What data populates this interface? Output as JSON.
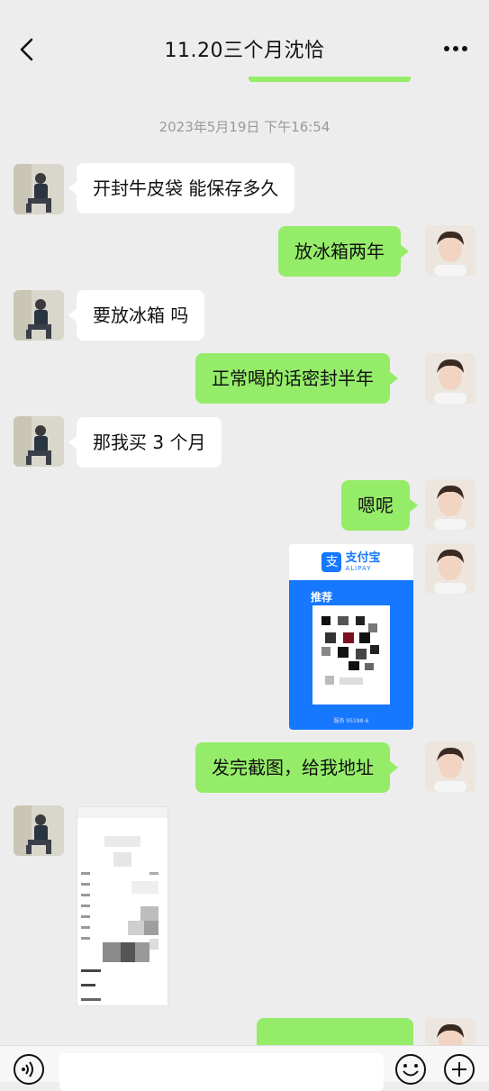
{
  "header": {
    "title": "11.20三个月沈恰",
    "back_icon": "chevron-left-icon",
    "more_icon": "more-dots-icon"
  },
  "timestamp": "2023年5月19日 下午16:54",
  "messages": [
    {
      "side": "in",
      "text": "开封牛皮袋  能保存多久"
    },
    {
      "side": "out",
      "text": "放冰箱两年"
    },
    {
      "side": "in",
      "text": "要放冰箱 吗"
    },
    {
      "side": "out",
      "text": "正常喝的话密封半年"
    },
    {
      "side": "in",
      "text": "那我买 3 个月"
    },
    {
      "side": "out",
      "text": "嗯呢"
    },
    {
      "side": "out",
      "type": "image",
      "text": "alipay-qr-code-image"
    },
    {
      "side": "out",
      "text": "发完截图，给我地址"
    },
    {
      "side": "in",
      "type": "image",
      "text": "screenshot-image"
    }
  ],
  "alipay": {
    "logo": "支",
    "name": "支付宝",
    "en": "ALIPAY",
    "label": "推荐",
    "footer": "服务 95188-6"
  },
  "colors": {
    "background": "#ededed",
    "outgoing_bubble": "#95ec69",
    "incoming_bubble": "#ffffff",
    "alipay_blue": "#1677ff"
  },
  "composer": {
    "voice_icon": "voice-icon",
    "emoji_icon": "emoji-icon",
    "plus_icon": "plus-icon"
  }
}
